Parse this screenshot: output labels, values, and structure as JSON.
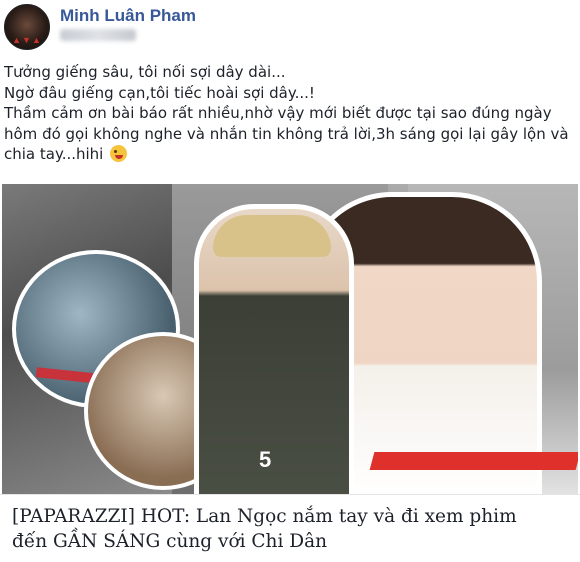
{
  "post": {
    "author": "Minh Luân Pham",
    "lines": [
      "Tưởng giếng sâu, tôi nối sợi dây dài...",
      "Ngờ đâu giếng cạn,tôi tiếc hoài sợi dây...!",
      "Thầm cảm ơn bài báo rất nhiều,nhờ vậy mới biết được tại sao đúng ngày",
      "hôm đó gọi không nghe và nhắn tin không trả lời,3h sáng gọi lại gây lộn và",
      "chia tay...hihi"
    ],
    "emoji": "winking-face-with-tongue-icon"
  },
  "link": {
    "title_line1": "[PAPARAZZI] HOT: Lan Ngọc nắm tay và đi xem phim",
    "title_line2": "đến GẦN SÁNG cùng với Chi Dân",
    "image_text": "5"
  },
  "colors": {
    "author": "#385898",
    "text": "#1d2129",
    "accent_red": "#e0302c"
  }
}
